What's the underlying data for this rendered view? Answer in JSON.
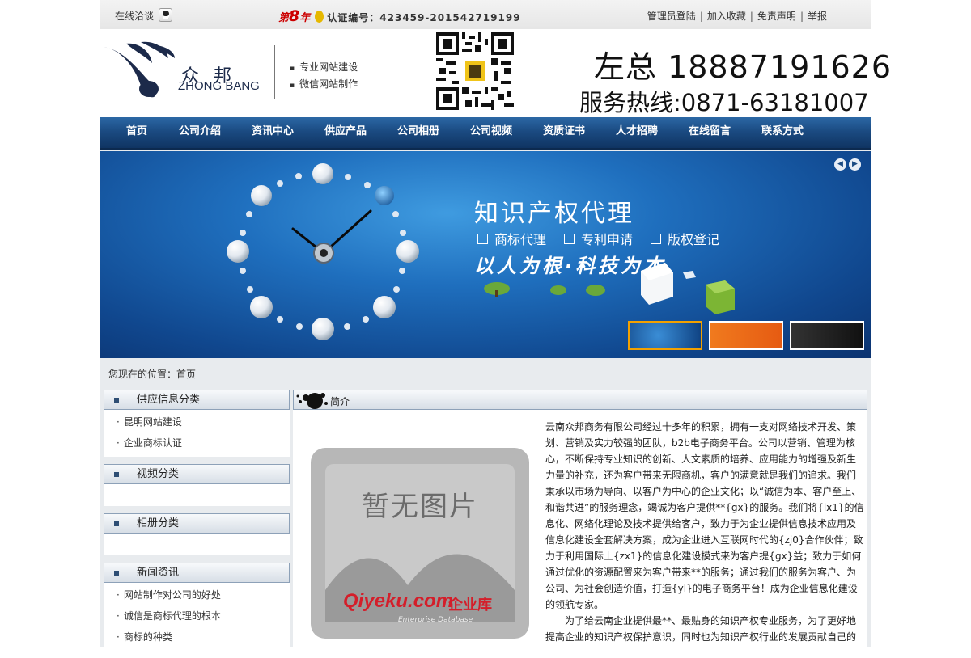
{
  "topbar": {
    "online": "在线洽谈",
    "nth_prefix": "第",
    "nth_number": "8",
    "nth_suffix": "年",
    "cert_label": "认证编号：423459-201542719199",
    "links": [
      "管理员登陆",
      "加入收藏",
      "免责声明",
      "举报"
    ]
  },
  "header": {
    "logo_cn": "众邦",
    "logo_en": "ZHONG BANG",
    "slogans": [
      "专业网站建设",
      "微信网站制作"
    ],
    "boss": "左总 18887191626",
    "hotline": "服务热线:0871-63181007"
  },
  "nav": [
    "首页",
    "公司介绍",
    "资讯中心",
    "供应产品",
    "公司相册",
    "公司视频",
    "资质证书",
    "人才招聘",
    "在线留言",
    "联系方式"
  ],
  "banner": {
    "title": "知识产权代理",
    "tags": [
      "商标代理",
      "专利申请",
      "版权登记"
    ],
    "motto": "以人为根·科技为本"
  },
  "breadcrumb": "您现在的位置：首页",
  "sidebar": {
    "supply": {
      "title": "供应信息分类",
      "items": [
        "昆明网站建设",
        "企业商标认证"
      ]
    },
    "video": {
      "title": "视频分类",
      "items": []
    },
    "album": {
      "title": "相册分类",
      "items": []
    },
    "news": {
      "title": "新闻资讯",
      "items": [
        "网站制作对公司的好处",
        "诚信是商标代理的根本",
        "商标的种类"
      ]
    }
  },
  "main": {
    "title": "简介",
    "placeholder": "暂无图片",
    "brand": "Qiyeku.com",
    "brand_cn": "企业库",
    "brand_en": "Enterprise Database",
    "intro_p1": "云南众邦商务有限公司经过十多年的积累，拥有一支对网络技术开发、策划、营销及实力较强的团队，b2b电子商务平台。公司以营销、管理为核心，不断保持专业知识的创新、人文素质的培养、应用能力的增强及新生力量的补充，还为客户带来无限商机，客户的满意就是我们的追求。我们秉承以市场为导向、以客户为中心的企业文化；以“诚信为本、客户至上、和谐共进”的服务理念，竭诚为客户提供**{gx}的服务。我们将{lx1}的信息化、网络化理论及技术提供给客户，致力于为企业提供信息技术应用及信息化建设全套解决方案，成为企业进入互联网时代的{zj0}合作伙伴；致力于利用国际上{zx1}的信息化建设模式来为客户提{gx}益；致力于如何通过优化的资源配置来为客户带来**的服务；通过我们的服务为客户、为公司、为社会创造价值，打造{yl}的电子商务平台！成为企业信息化建设的领航专家。",
    "intro_p2": "为了给云南企业提供最**、最贴身的知识产权专业服务，为了更好地提高企业的知识产权保护意识，同时也为知识产权行业的发展贡献自己的"
  }
}
